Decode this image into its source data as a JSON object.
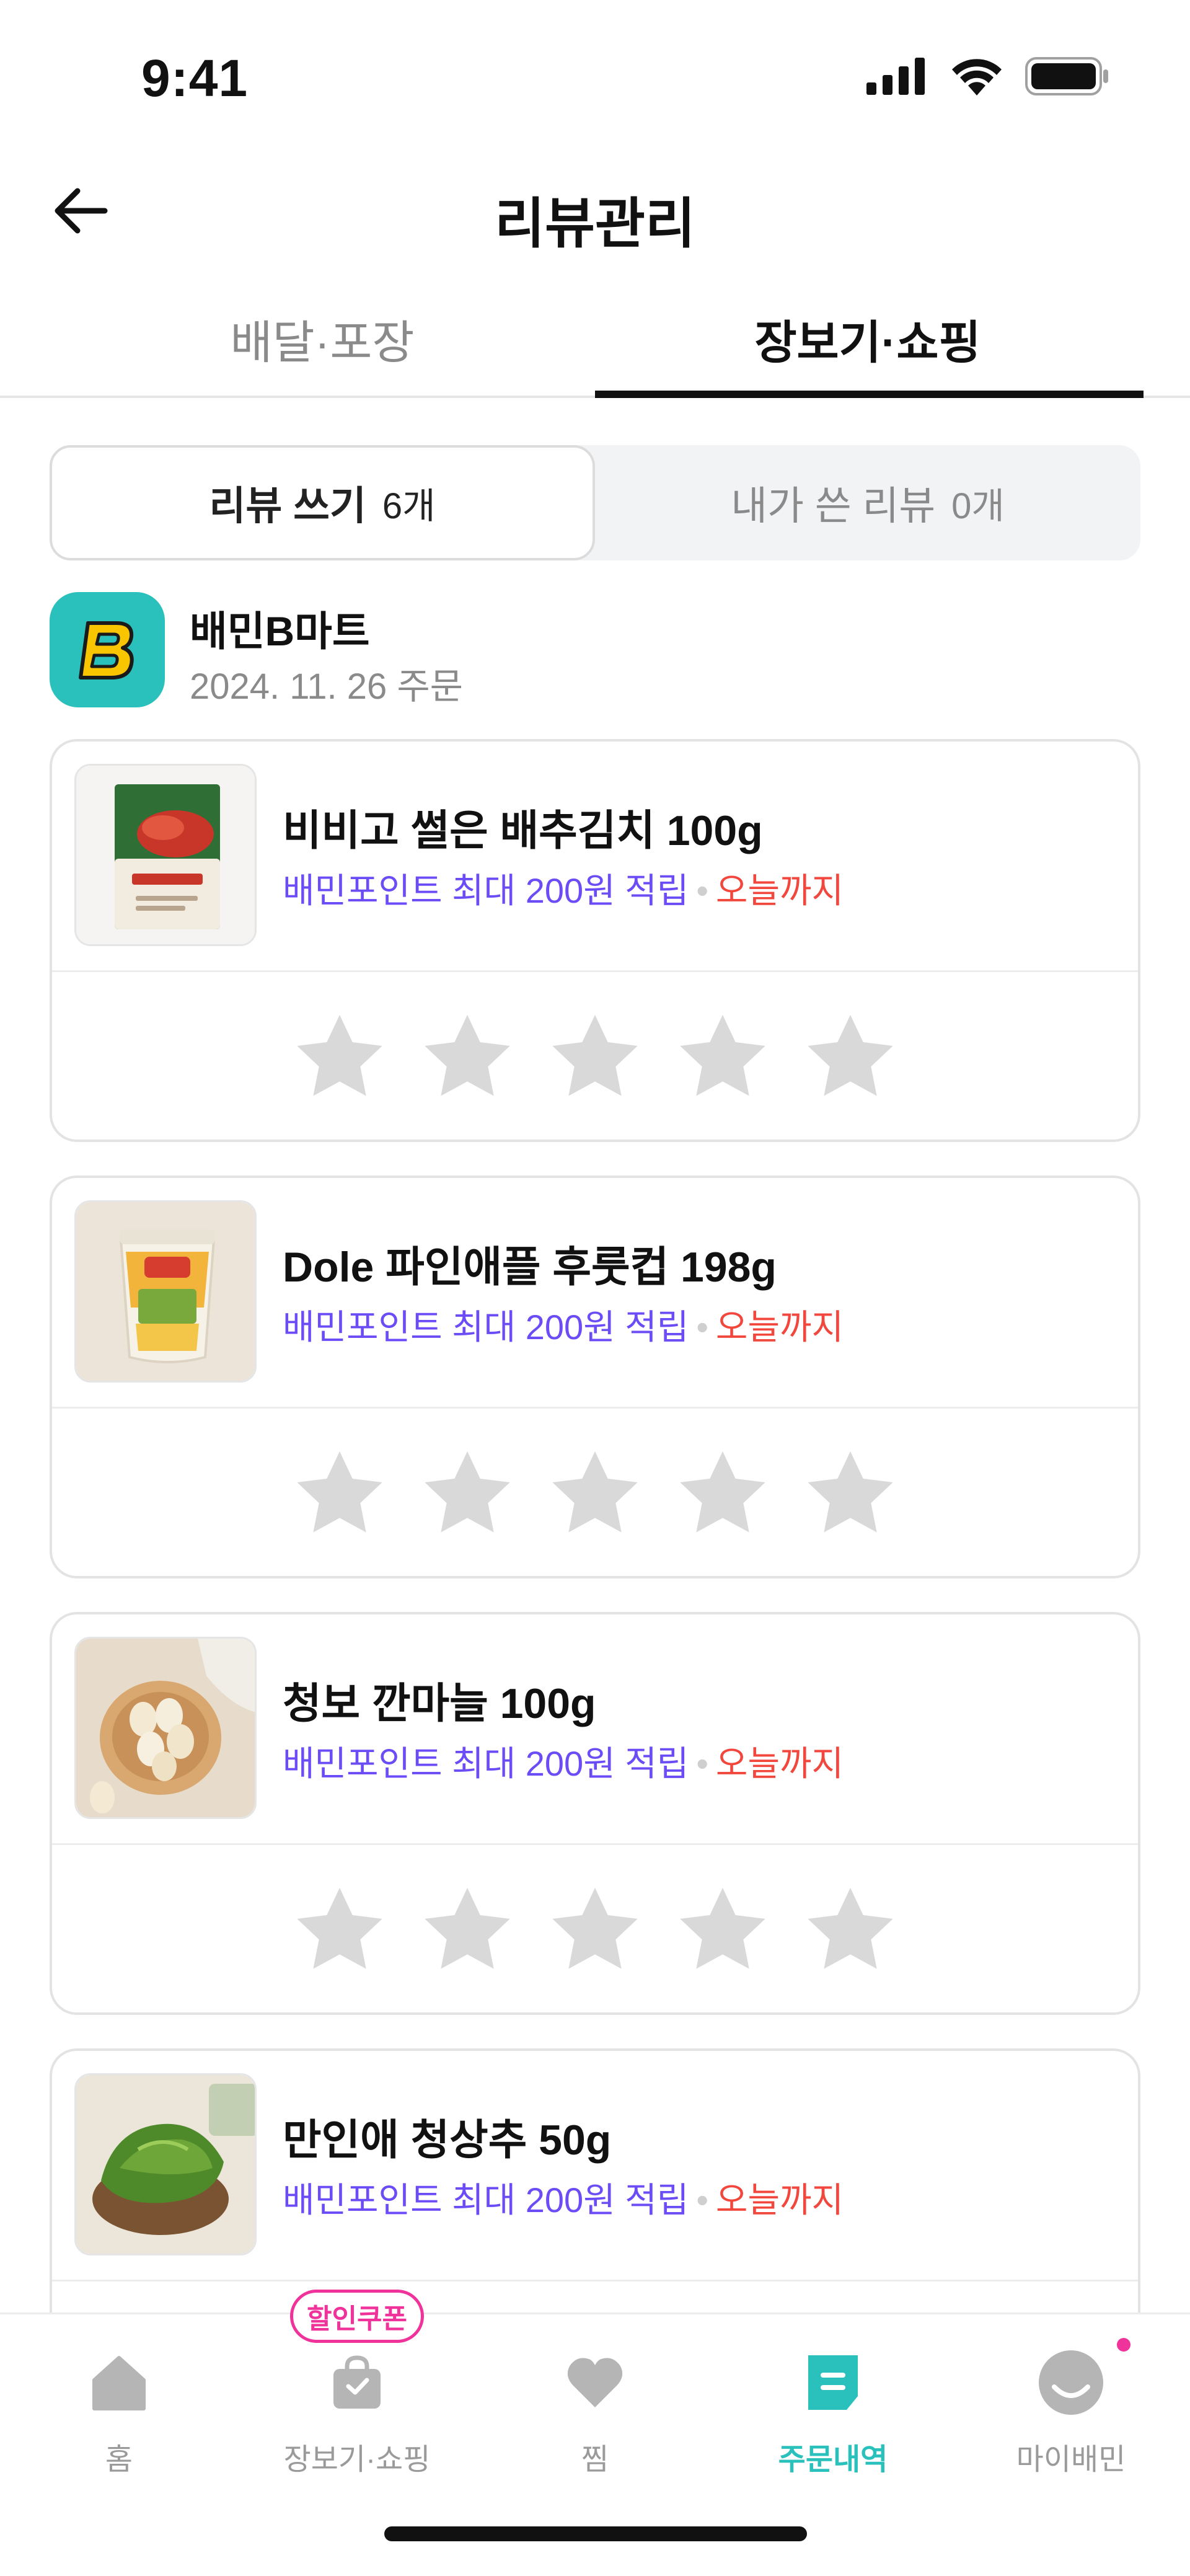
{
  "status_bar": {
    "time": "9:41"
  },
  "nav": {
    "title": "리뷰관리"
  },
  "tabs": [
    {
      "label": "배달·포장",
      "active": false
    },
    {
      "label": "장보기·쇼핑",
      "active": true
    }
  ],
  "segment": {
    "write": {
      "label": "리뷰 쓰기",
      "count": "6개"
    },
    "mine": {
      "label": "내가 쓴 리뷰",
      "count": "0개"
    }
  },
  "store": {
    "name": "배민B마트",
    "order_date": "2024. 11. 26 주문",
    "logo_letter": "B"
  },
  "products": [
    {
      "name": "비비고 썰은 배추김치 100g",
      "points": "배민포인트 최대 200원 적립",
      "deadline": "오늘까지"
    },
    {
      "name": "Dole 파인애플 후룻컵 198g",
      "points": "배민포인트 최대 200원 적립",
      "deadline": "오늘까지"
    },
    {
      "name": "청보 깐마늘 100g",
      "points": "배민포인트 최대 200원 적립",
      "deadline": "오늘까지"
    },
    {
      "name": "만인애 청상추 50g",
      "points": "배민포인트 최대 200원 적립",
      "deadline": "오늘까지"
    }
  ],
  "bottom_nav": {
    "coupon_badge": "할인쿠폰",
    "items": [
      {
        "label": "홈",
        "icon": "home-icon"
      },
      {
        "label": "장보기·쇼핑",
        "icon": "shopping-bag-icon"
      },
      {
        "label": "찜",
        "icon": "heart-icon"
      },
      {
        "label": "주문내역",
        "icon": "receipt-icon",
        "active": true
      },
      {
        "label": "마이배민",
        "icon": "profile-icon"
      }
    ]
  },
  "colors": {
    "accent_mint": "#2ac1bc",
    "point_purple": "#6b4cf6",
    "deadline_red": "#f2473d",
    "coupon_pink": "#f0329b",
    "star_gray": "#d9d9d9"
  }
}
